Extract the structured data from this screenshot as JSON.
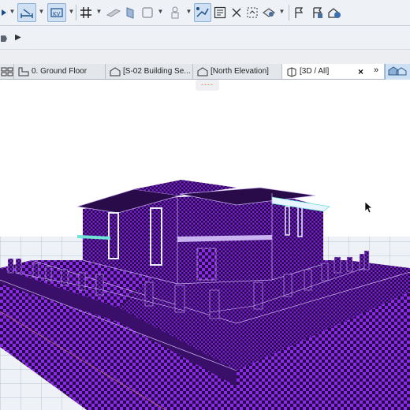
{
  "toolbar": {
    "icons": [
      "arrow-tool-icon",
      "dimension-tool-icon",
      "gravity-icon",
      "grid-snap-icon",
      "guide-line-icon",
      "edit-plane-icon",
      "suspend-groups-icon",
      "trace-icon",
      "renovation-filter-icon",
      "marquee-icon",
      "clip-icon",
      "find-select-icon",
      "layer-flag-icon",
      "favorites-flag-icon",
      "model-view-icon"
    ]
  },
  "subbar": {
    "icons": [
      "hand-cursor-icon",
      "expand-arrow-icon"
    ]
  },
  "tabs": [
    {
      "label": "0. Ground Floor",
      "icon": "floor-plan-icon"
    },
    {
      "label": "[S-02 Building Se...",
      "icon": "section-icon"
    },
    {
      "label": "[North Elevation]",
      "icon": "elevation-icon"
    },
    {
      "label": "[3D / All]",
      "icon": "3d-view-icon",
      "active": true
    }
  ],
  "tab_controls": {
    "close": "×",
    "more": "»",
    "icon": "view-navigator-icon"
  },
  "viewport": {
    "nav_indicator": "----",
    "colors": {
      "model_purple": "#7a1ed6",
      "model_dark": "#2a0b4a",
      "ground_purple": "#8a2bea",
      "glass": "#6fe3d6"
    }
  }
}
